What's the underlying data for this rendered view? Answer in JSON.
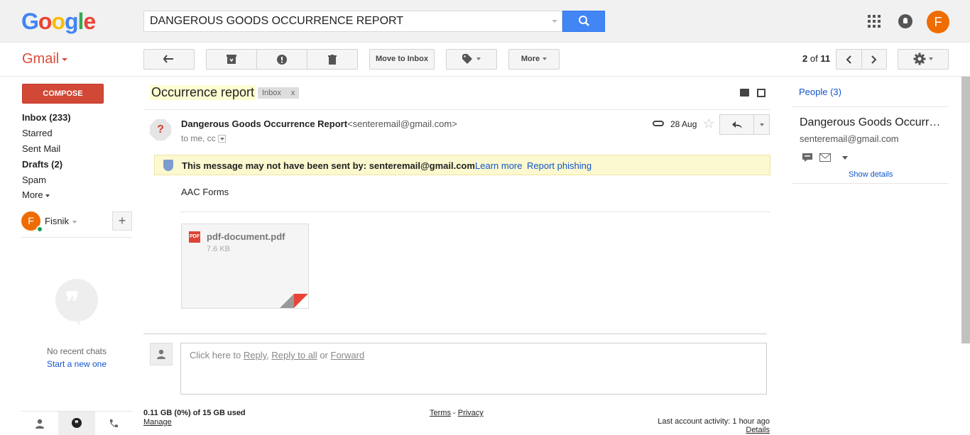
{
  "header": {
    "logo": [
      "G",
      "o",
      "o",
      "g",
      "l",
      "e"
    ],
    "logo_colors": [
      "#4285f4",
      "#ea4335",
      "#fbbc05",
      "#4285f4",
      "#34a853",
      "#ea4335"
    ],
    "search_value": "DANGEROUS GOODS OCCURRENCE REPORT",
    "avatar_letter": "F"
  },
  "toolbar": {
    "app_label": "Gmail",
    "move_to_inbox": "Move to Inbox",
    "more": "More",
    "pager_current": "2",
    "pager_of": "of",
    "pager_total": "11"
  },
  "sidebar": {
    "compose": "COMPOSE",
    "items": [
      {
        "label": "Inbox (233)",
        "bold": true
      },
      {
        "label": "Starred",
        "bold": false
      },
      {
        "label": "Sent Mail",
        "bold": false
      },
      {
        "label": "Drafts (2)",
        "bold": true
      },
      {
        "label": "Spam",
        "bold": false
      },
      {
        "label": "More",
        "bold": false
      }
    ],
    "user_letter": "F",
    "user_name": "Fisnik",
    "no_chats": "No recent chats",
    "start_new": "Start a new one"
  },
  "email": {
    "subject": "Occurrence report",
    "label_chip": "Inbox",
    "label_chip_close": "x",
    "sender_name": "Dangerous Goods Occurrence Report",
    "sender_email": "<senteremail@gmail.com>",
    "to_line": "to me, cc",
    "date": "28 Aug",
    "warning": "This message may not have been sent by: senteremail@gmail.com",
    "learn_more": "Learn more",
    "report_phishing": "Report phishing",
    "body": "AAC Forms",
    "attachment": {
      "name": "pdf-document.pdf",
      "size": "7.6 KB",
      "badge": "PDF"
    },
    "reply_prefix": "Click here to",
    "reply": "Reply",
    "reply_all": "Reply to all",
    "reply_or": "or",
    "forward": "Forward"
  },
  "footer": {
    "storage": "0.11 GB (0%) of 15 GB used",
    "manage": "Manage",
    "terms": "Terms",
    "privacy": "Privacy",
    "activity": "Last account activity: 1 hour ago",
    "details": "Details"
  },
  "people": {
    "header": "People (3)",
    "name": "Dangerous Goods Occurrence Report",
    "email": "senteremail@gmail.com",
    "show_details": "Show details"
  },
  "colors": {
    "accent_blue": "#4285f4",
    "compose_red": "#d14836",
    "link": "#1155cc",
    "warning_bg": "#fcf8cf"
  }
}
